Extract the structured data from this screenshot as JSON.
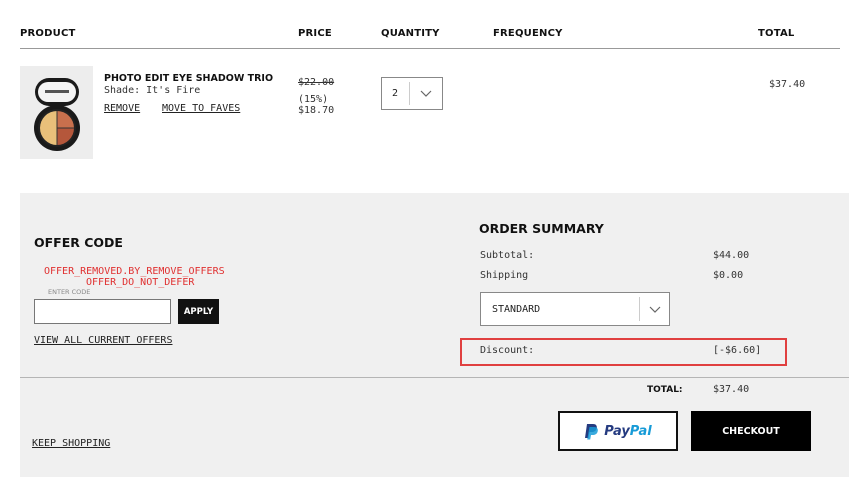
{
  "table_header": {
    "product": "PRODUCT",
    "price": "PRICE",
    "quantity": "QUANTITY",
    "frequency": "FREQUENCY",
    "total": "TOTAL"
  },
  "item": {
    "name": "PHOTO EDIT EYE SHADOW TRIO",
    "shade": "Shade: It's Fire",
    "remove_label": "REMOVE",
    "faves_label": "MOVE TO FAVES",
    "price_original": "$22.00",
    "discount_pct": "(15%)",
    "price_sale": "$18.70",
    "quantity": "2",
    "line_total": "$37.40",
    "thumbnail_icon": "eyeshadow-compact-icon"
  },
  "offer": {
    "title": "OFFER CODE",
    "error_line1": "OFFER_REMOVED.BY_REMOVE_OFFERS",
    "error_line2": "OFFER_DO_NOT_DEFER",
    "input_label": "ENTER CODE",
    "input_value": "",
    "apply_label": "APPLY",
    "view_all_label": "VIEW ALL CURRENT OFFERS"
  },
  "summary": {
    "title": "ORDER SUMMARY",
    "subtotal_label": "Subtotal:",
    "subtotal_value": "$44.00",
    "shipping_label": "Shipping",
    "shipping_value": "$0.00",
    "shipping_method": "STANDARD",
    "discount_label": "Discount:",
    "discount_value": "[-$6.60]",
    "total_label": "TOTAL:",
    "total_value": "$37.40"
  },
  "actions": {
    "paypal_pay": "Pay",
    "paypal_pal": "Pal",
    "checkout_label": "CHECKOUT",
    "keep_shopping_label": "KEEP SHOPPING"
  },
  "colors": {
    "error_text": "#e03030",
    "highlight_border": "#e04040",
    "panel_bg": "#f0f0f0",
    "paypal_dark": "#253b80",
    "paypal_light": "#179bd7"
  }
}
